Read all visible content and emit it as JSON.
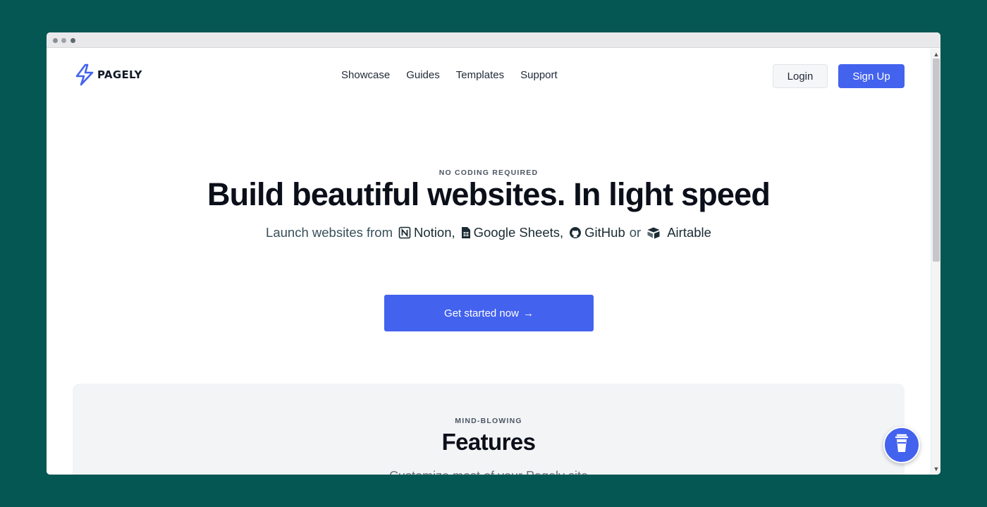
{
  "header": {
    "brand": "PAGELY",
    "nav": [
      "Showcase",
      "Guides",
      "Templates",
      "Support"
    ],
    "login_label": "Login",
    "signup_label": "Sign Up"
  },
  "hero": {
    "eyebrow": "NO CODING REQUIRED",
    "headline": "Build beautiful websites. In light speed",
    "sub_prefix": "Launch websites from",
    "sources": [
      {
        "name": "Notion",
        "icon": "notion-icon",
        "suffix": ","
      },
      {
        "name": "Google Sheets",
        "icon": "google-sheets-icon",
        "suffix": ","
      },
      {
        "name": "GitHub",
        "icon": "github-icon",
        "suffix": ""
      },
      {
        "name": "Airtable",
        "icon": "airtable-icon",
        "suffix": ""
      }
    ],
    "or_text": "or",
    "cta_label": "Get started now",
    "cta_arrow": "→"
  },
  "features": {
    "eyebrow": "MIND-BLOWING",
    "title": "Features",
    "description": "Customize most of your Pagely site"
  },
  "colors": {
    "accent": "#4362ee",
    "page_background": "#045752",
    "features_background": "#f3f4f6"
  },
  "widgets": {
    "coffee_icon": "coffee-cup-icon"
  }
}
